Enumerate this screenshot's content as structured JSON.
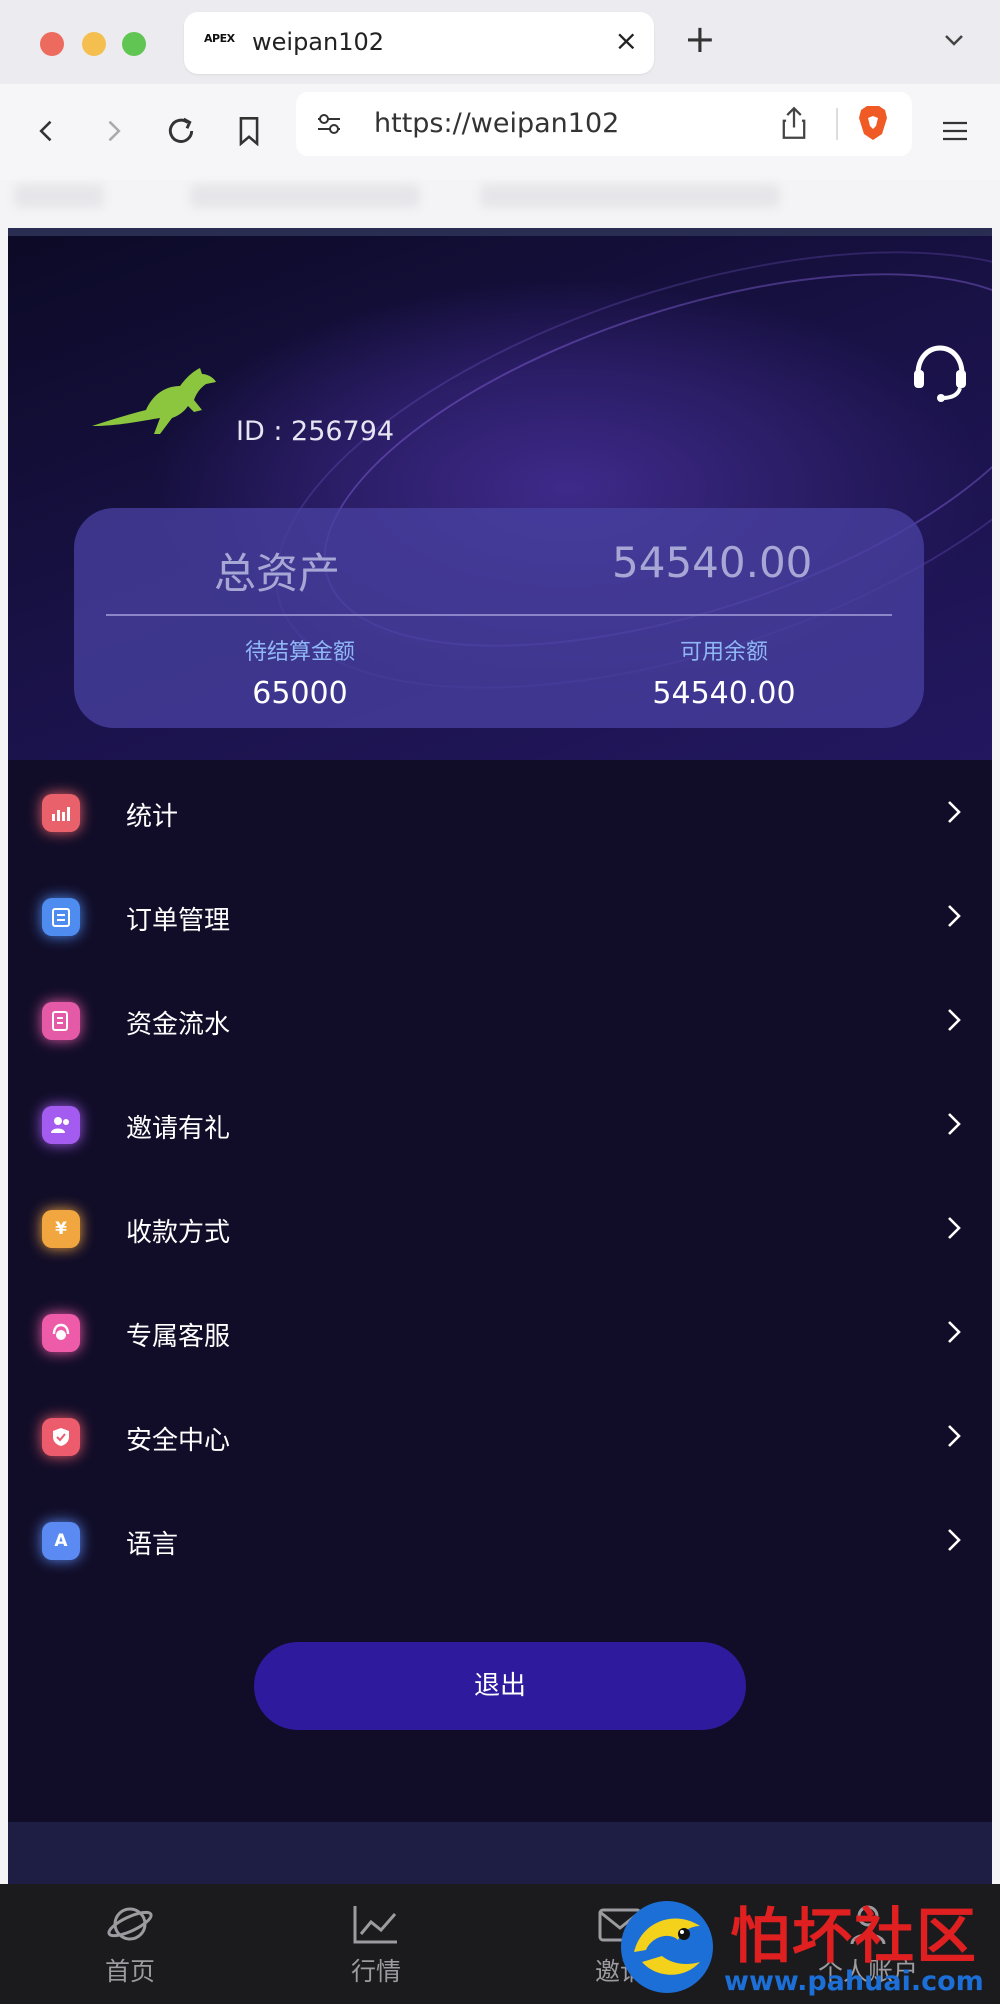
{
  "browser": {
    "tab_title": "weipan102",
    "tab_favicon_text": "APEX",
    "url": "https://weipan102",
    "colors": {
      "close": "#ed6a5e",
      "minimize": "#f5bf4f",
      "maximize": "#61c554",
      "brave": "#f05a24"
    }
  },
  "profile": {
    "id_text": "ID : 256794"
  },
  "assets": {
    "total_label": "总资产",
    "total_value": "54540.00",
    "pending_label": "待结算金额",
    "pending_value": "65000",
    "available_label": "可用余额",
    "available_value": "54540.00"
  },
  "menu": {
    "items": [
      {
        "label": "统计",
        "icon": "chart-icon",
        "color": "#e8616b"
      },
      {
        "label": "订单管理",
        "icon": "order-icon",
        "color": "#4f8cf0"
      },
      {
        "label": "资金流水",
        "icon": "ledger-icon",
        "color": "#e45aa6"
      },
      {
        "label": "邀请有礼",
        "icon": "invite-icon",
        "color": "#a45cf0"
      },
      {
        "label": "收款方式",
        "icon": "payment-icon",
        "color": "#f2a640"
      },
      {
        "label": "专属客服",
        "icon": "support-icon",
        "color": "#ee5ba8"
      },
      {
        "label": "安全中心",
        "icon": "shield-icon",
        "color": "#ec5c6c"
      },
      {
        "label": "语言",
        "icon": "language-icon",
        "color": "#5a8af2"
      }
    ],
    "payment_glyph": "¥",
    "language_glyph": "A"
  },
  "logout_label": "退出",
  "bottom_nav": {
    "home": "首页",
    "market": "行情",
    "invite": "邀请",
    "account": "个人账户"
  },
  "watermark": {
    "title": "怕坏社区",
    "url": "www.pahuai.com"
  }
}
